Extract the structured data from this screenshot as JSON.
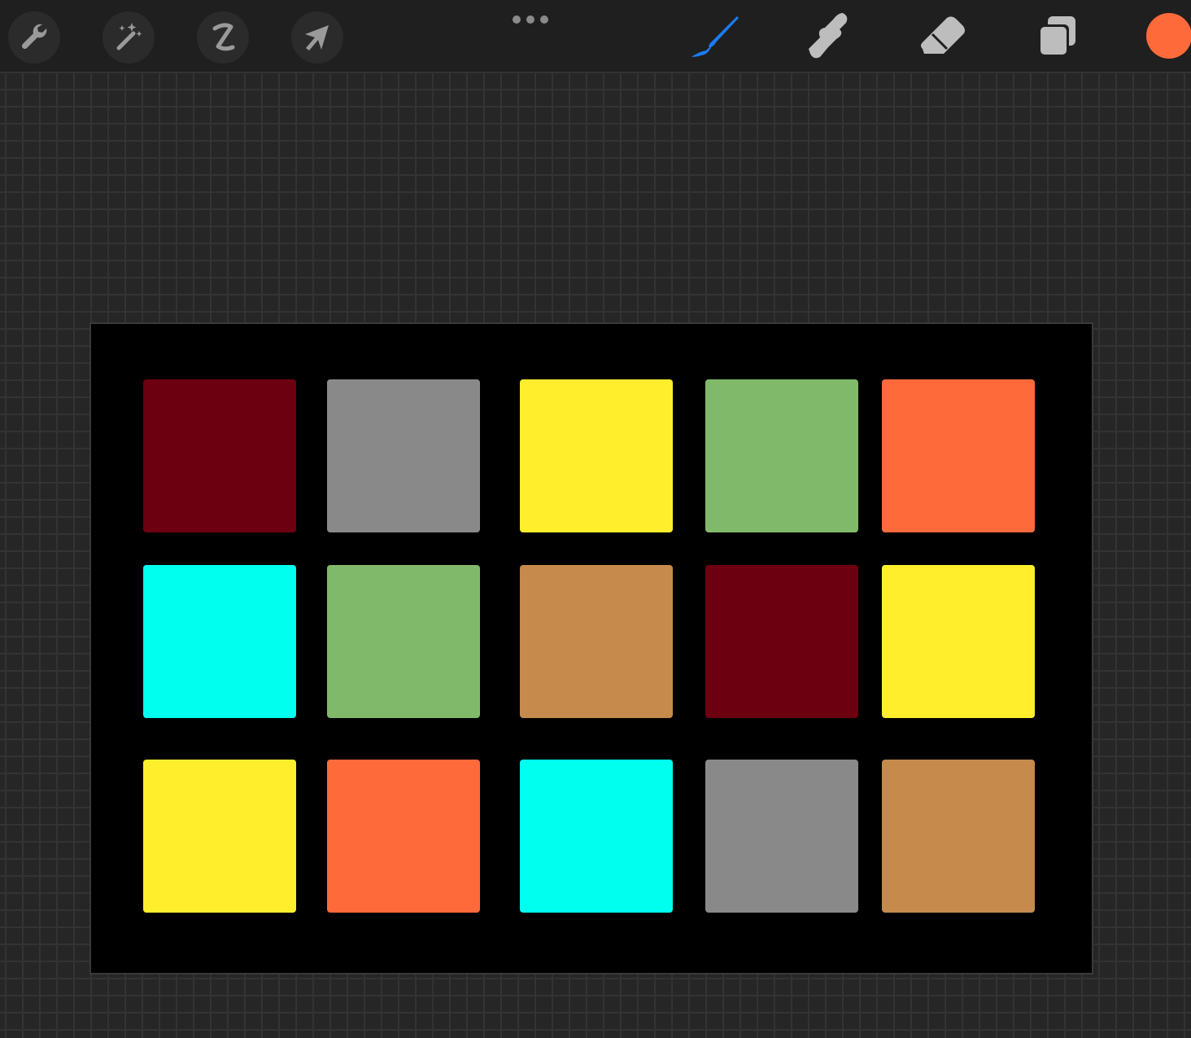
{
  "toolbar": {
    "left_tools": [
      {
        "name": "actions",
        "icon": "wrench-icon"
      },
      {
        "name": "adjustments",
        "icon": "magic-wand-icon"
      },
      {
        "name": "selection",
        "icon": "selection-s-icon"
      },
      {
        "name": "transform",
        "icon": "arrow-cursor-icon"
      }
    ],
    "more_icon": "ellipsis-icon",
    "right_tools": [
      {
        "name": "brush",
        "icon": "brush-icon",
        "active": true
      },
      {
        "name": "smudge",
        "icon": "smudge-finger-icon",
        "active": false
      },
      {
        "name": "eraser",
        "icon": "eraser-icon",
        "active": false
      },
      {
        "name": "layers",
        "icon": "layers-icon",
        "active": false
      }
    ],
    "current_color": "#FF6A3A",
    "active_tool_color": "#1A7CF5",
    "inactive_tool_color": "#BDBDBD"
  },
  "canvas": {
    "background": "#000000",
    "swatches": [
      [
        "#6D0010",
        "#898989",
        "#FFEE2C",
        "#81B96A",
        "#FF6A3A"
      ],
      [
        "#00FFEF",
        "#81B96A",
        "#C58A4C",
        "#6D0010",
        "#FFEE2C"
      ],
      [
        "#FFEE2C",
        "#FF6A3A",
        "#00FFEF",
        "#898989",
        "#C58A4C"
      ]
    ]
  }
}
